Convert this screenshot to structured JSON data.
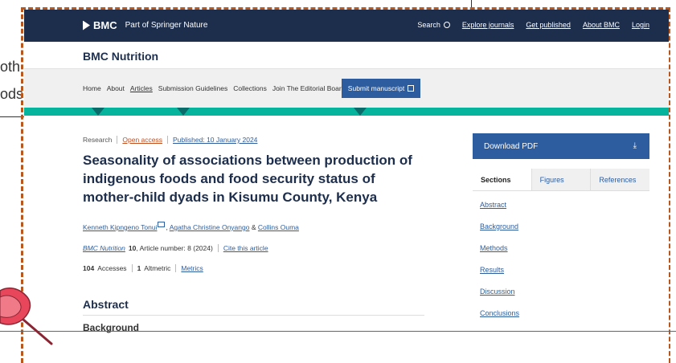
{
  "background": {
    "fragment_1": "oth",
    "fragment_2": "ods"
  },
  "topbar": {
    "logo": "BMC",
    "logo_sub": "Part of Springer Nature",
    "search": "Search",
    "links": [
      "Explore journals",
      "Get published",
      "About BMC",
      "Login"
    ]
  },
  "journal": {
    "title": "BMC Nutrition"
  },
  "nav": {
    "links": [
      "Home",
      "About",
      "Articles",
      "Submission Guidelines",
      "Collections",
      "Join The Editorial Board"
    ],
    "submit": "Submit manuscript"
  },
  "article": {
    "type": "Research",
    "open_access": "Open access",
    "published": "Published: 10 January 2024",
    "title": "Seasonality of associations between production of indigenous foods and food security status of mother-child dyads in Kisumu County, Kenya",
    "author_1": "Kenneth Kipngeno Tonui",
    "author_2": "Agatha Christine Onyango",
    "author_sep": "&",
    "author_3": "Collins Ouma",
    "journal_ref": "BMC Nutrition",
    "volume": "10",
    "article_number": ", Article number: 8 (2024)",
    "cite": "Cite this article",
    "accesses_count": "104",
    "accesses_label": "Accesses",
    "altmetric_count": "1",
    "altmetric_label": "Altmetric",
    "metrics": "Metrics",
    "abstract_heading": "Abstract",
    "background_heading": "Background"
  },
  "sidebar": {
    "download": "Download PDF",
    "download_icon": "⤓",
    "tabs": [
      "Sections",
      "Figures",
      "References"
    ],
    "sections": [
      "Abstract",
      "Background",
      "Methods",
      "Results",
      "Discussion",
      "Conclusions"
    ]
  },
  "colors": {
    "navy": "#1d2e4c",
    "accent_blue": "#2d5d9e",
    "teal": "#06b39c",
    "frame": "#b8581f",
    "pin": "#e8475b"
  }
}
